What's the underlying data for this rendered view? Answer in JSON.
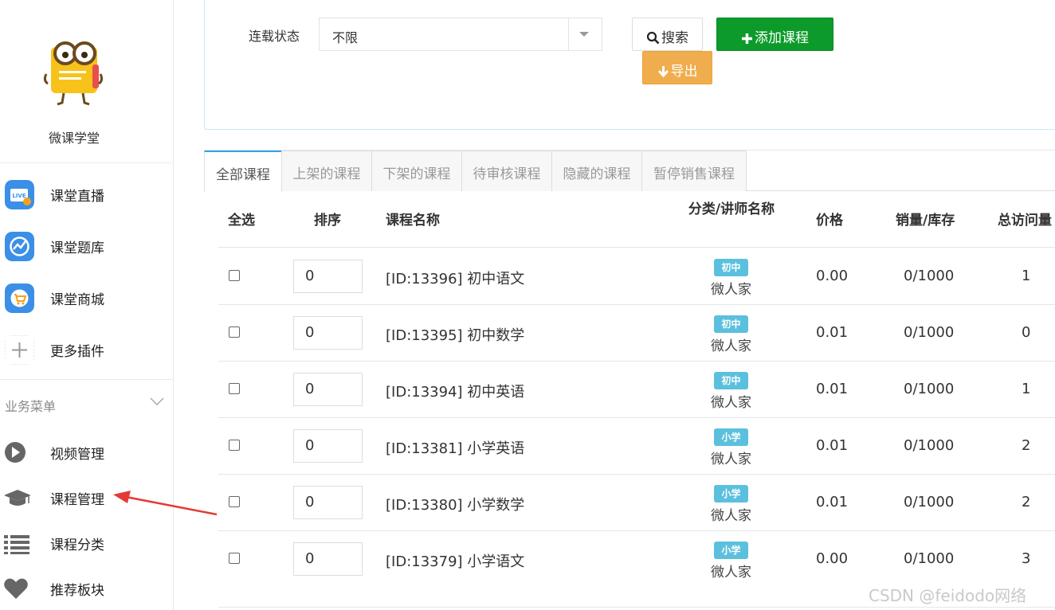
{
  "sidebar": {
    "brand_name": "微课学堂",
    "plugins": [
      {
        "label": "课堂直播",
        "icon": "live-tv-icon",
        "icon_text": "LIVE",
        "color": "#3b8fe6"
      },
      {
        "label": "课堂题库",
        "icon": "question-bank-icon",
        "color": "#3b8fe6"
      },
      {
        "label": "课堂商城",
        "icon": "shopping-cart-icon",
        "color": "#3b8fe6"
      },
      {
        "label": "更多插件",
        "icon": "plus-icon",
        "color": "#999999"
      }
    ],
    "business_menu_label": "业务菜单",
    "menu": [
      {
        "label": "视频管理",
        "icon": "play-circle-icon"
      },
      {
        "label": "课程管理",
        "icon": "graduation-cap-icon"
      },
      {
        "label": "课程分类",
        "icon": "list-icon"
      },
      {
        "label": "推荐板块",
        "icon": "heart-icon"
      }
    ]
  },
  "filter": {
    "status_label": "连载状态",
    "status_value": "不限",
    "search_label": "搜索",
    "add_course_label": "添加课程",
    "export_label": "导出"
  },
  "tabs": [
    "全部课程",
    "上架的课程",
    "下架的课程",
    "待审核课程",
    "隐藏的课程",
    "暂停销售课程"
  ],
  "table": {
    "headers": {
      "select_all": "全选",
      "sort": "排序",
      "name": "课程名称",
      "category": "分类/讲师名称",
      "price": "价格",
      "sales_stock": "销量/库存",
      "visits": "总访问量"
    },
    "rows": [
      {
        "sort": "0",
        "name": "[ID:13396] 初中语文",
        "category": "初中",
        "teacher": "微人家",
        "price": "0.00",
        "sales_stock": "0/1000",
        "visits": "1"
      },
      {
        "sort": "0",
        "name": "[ID:13395] 初中数学",
        "category": "初中",
        "teacher": "微人家",
        "price": "0.01",
        "sales_stock": "0/1000",
        "visits": "0"
      },
      {
        "sort": "0",
        "name": "[ID:13394] 初中英语",
        "category": "初中",
        "teacher": "微人家",
        "price": "0.01",
        "sales_stock": "0/1000",
        "visits": "1"
      },
      {
        "sort": "0",
        "name": "[ID:13381] 小学英语",
        "category": "小学",
        "teacher": "微人家",
        "price": "0.01",
        "sales_stock": "0/1000",
        "visits": "2"
      },
      {
        "sort": "0",
        "name": "[ID:13380] 小学数学",
        "category": "小学",
        "teacher": "微人家",
        "price": "0.01",
        "sales_stock": "0/1000",
        "visits": "2"
      },
      {
        "sort": "0",
        "name": "[ID:13379] 小学语文",
        "category": "小学",
        "teacher": "微人家",
        "price": "0.00",
        "sales_stock": "0/1000",
        "visits": "3"
      }
    ]
  },
  "watermark": "CSDN @feidodo网络",
  "colors": {
    "accent": "#2ea5e8",
    "add_button": "#0c9b2a",
    "export_button": "#f0ad4e",
    "badge": "#5bc0de",
    "annotation_arrow": "#e53935"
  }
}
